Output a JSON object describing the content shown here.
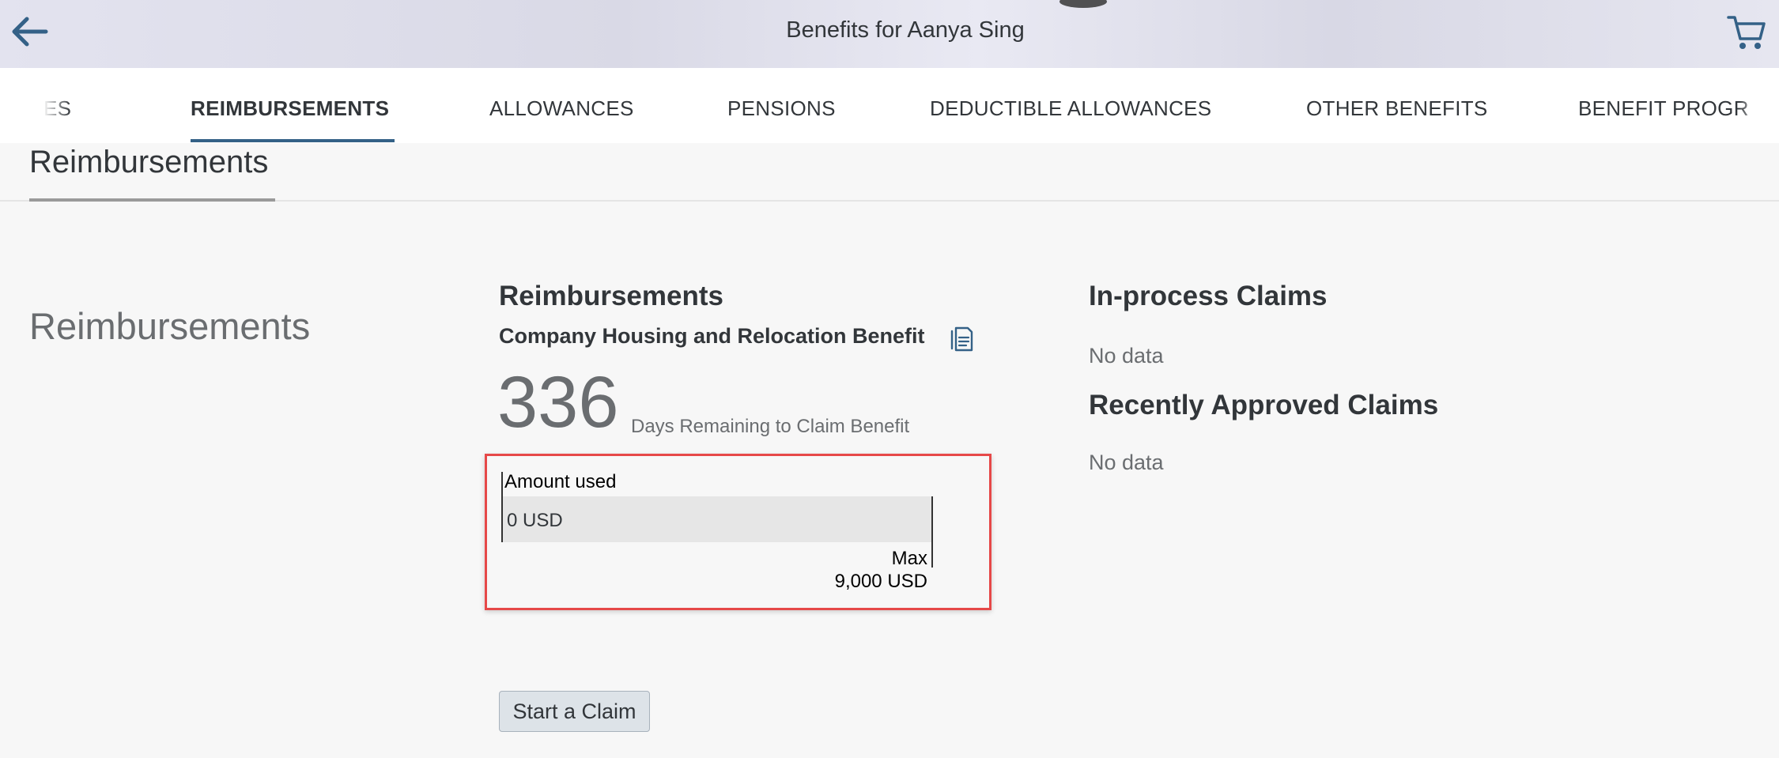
{
  "header": {
    "title": "Benefits for Aanya Sing",
    "back_icon": "arrow-left-icon",
    "cart_icon": "shopping-cart-icon",
    "accent_color": "#346187"
  },
  "tabs": [
    {
      "label": "ES",
      "active": false
    },
    {
      "label": "REIMBURSEMENTS",
      "active": true
    },
    {
      "label": "ALLOWANCES",
      "active": false
    },
    {
      "label": "PENSIONS",
      "active": false
    },
    {
      "label": "DEDUCTIBLE ALLOWANCES",
      "active": false
    },
    {
      "label": "OTHER BENEFITS",
      "active": false
    },
    {
      "label": "BENEFIT PROGR",
      "active": false
    }
  ],
  "section": {
    "tab_label": "Reimbursements",
    "side_title": "Reimbursements"
  },
  "card": {
    "title": "Reimbursements",
    "benefit_name": "Company Housing and Relocation Benefit",
    "doc_icon": "document-icon",
    "days_remaining": "336",
    "days_label": "Days Remaining to Claim Benefit",
    "amount_used_label": "Amount used",
    "amount_used_value": "0 USD",
    "amount_used_fraction": 0,
    "max_label": "Max",
    "max_value": "9,000 USD",
    "start_claim_label": "Start a Claim"
  },
  "claims": {
    "inprocess_title": "In-process Claims",
    "inprocess_empty": "No data",
    "approved_title": "Recently Approved Claims",
    "approved_empty": "No data"
  }
}
